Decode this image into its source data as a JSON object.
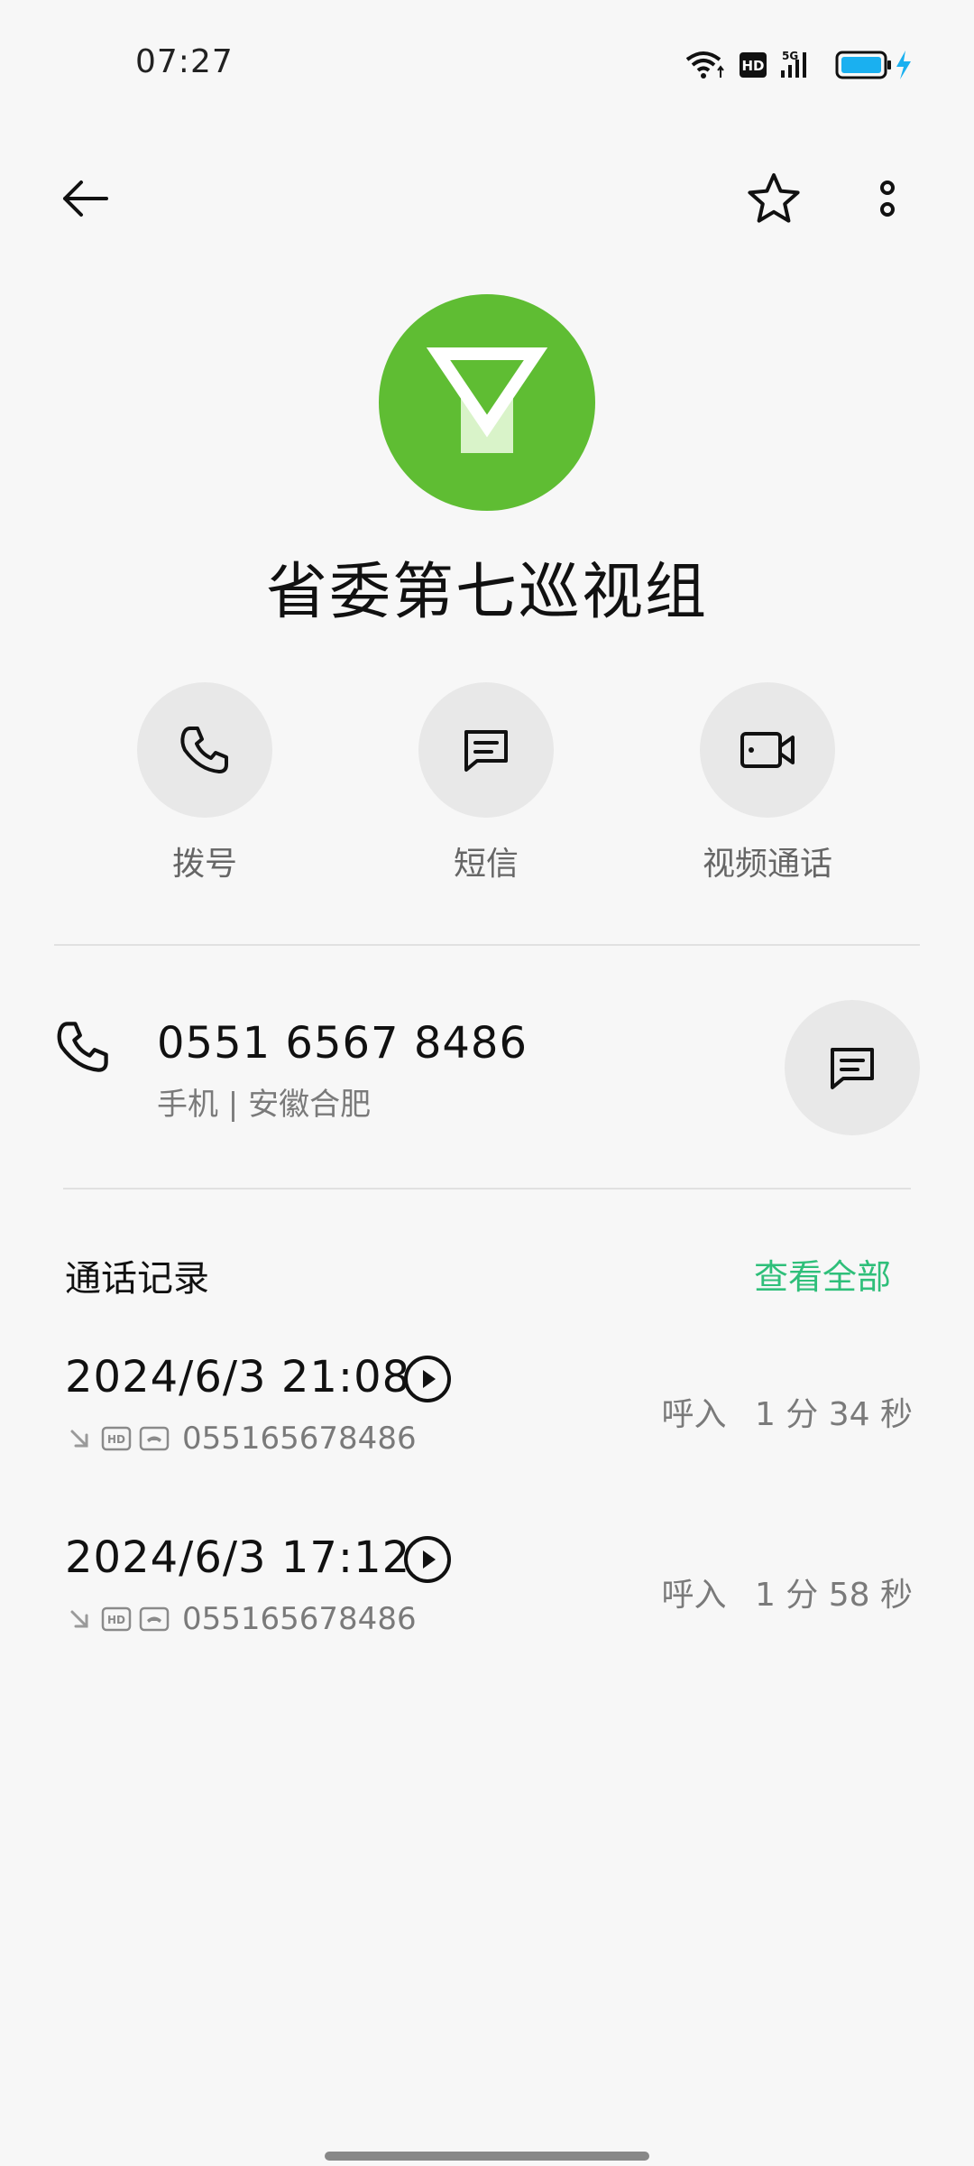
{
  "status_bar": {
    "time": "07:27",
    "icons": [
      "wifi-icon",
      "hd-icon",
      "signal-5g-icon",
      "battery-charging-icon"
    ],
    "hd_text": "HD",
    "net_text": "5G",
    "battery_color": "#1ab0f0"
  },
  "toolbar": {
    "back_icon": "arrow-left-icon",
    "favorite_icon": "star-outline-icon",
    "more_icon": "more-vertical-icon"
  },
  "contact": {
    "name": "省委第七巡视组",
    "avatar_color": "#5fbd33"
  },
  "actions": [
    {
      "icon": "phone-icon",
      "label": "拨号"
    },
    {
      "icon": "message-icon",
      "label": "短信"
    },
    {
      "icon": "video-camera-icon",
      "label": "视频通话"
    }
  ],
  "phone": {
    "number": "0551 6567 8486",
    "subtitle": "手机 | 安徽合肥"
  },
  "call_log": {
    "title": "通话记录",
    "view_all": "查看全部",
    "accent_color": "#2fbf7a",
    "records": [
      {
        "datetime": "2024/6/3 21:08",
        "number": "055165678486",
        "direction": "呼入",
        "duration": "1 分 34 秒"
      },
      {
        "datetime": "2024/6/3 17:12",
        "number": "055165678486",
        "direction": "呼入",
        "duration": "1 分 58 秒"
      }
    ]
  }
}
